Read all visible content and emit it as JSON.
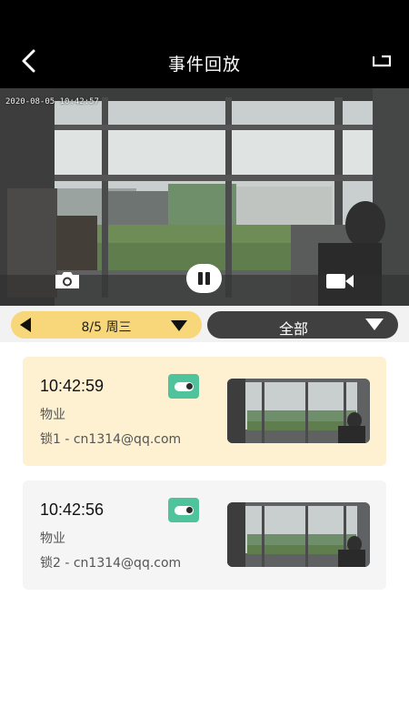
{
  "header": {
    "title": "事件回放",
    "back_icon": "chevron-left-icon",
    "fullscreen_icon": "fullscreen-icon"
  },
  "video": {
    "timestamp": "2020-08-05 10:42:57",
    "snapshot_icon": "camera-icon",
    "pause_icon": "pause-icon",
    "record_icon": "video-camera-icon"
  },
  "filter": {
    "date_label": "8/5 周三",
    "type_label": "全部",
    "colors": {
      "date_pill": "#f8d77a",
      "type_pill": "#404040"
    }
  },
  "events": [
    {
      "time": "10:42:59",
      "type": "物业",
      "user": "锁1 - cn1314@qq.com",
      "selected": true
    },
    {
      "time": "10:42:56",
      "type": "物业",
      "user": "锁2 - cn1314@qq.com",
      "selected": false
    }
  ],
  "colors": {
    "accent": "#4fc39c",
    "selected_card": "#fdf1d2"
  }
}
